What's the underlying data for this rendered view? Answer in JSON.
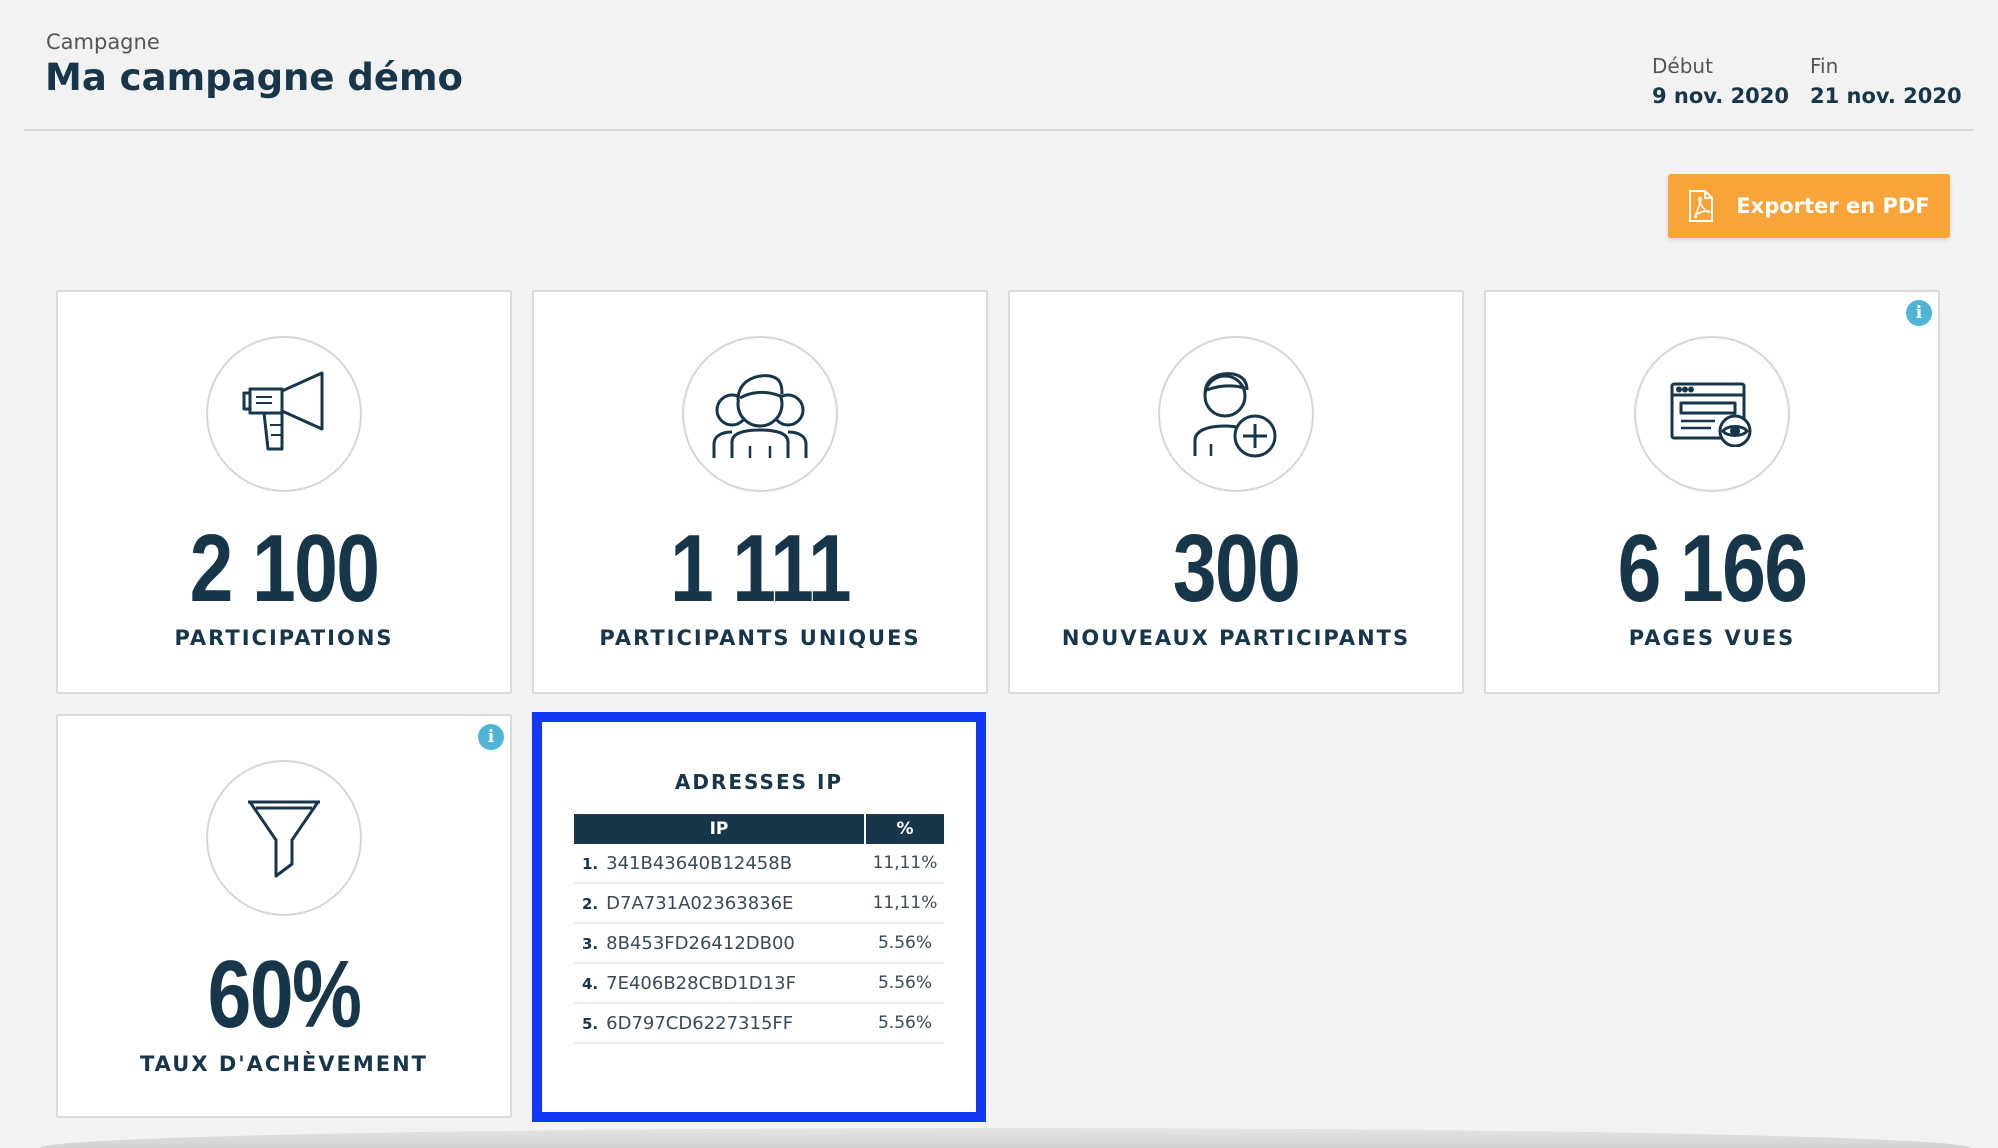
{
  "header": {
    "campaign_label": "Campagne",
    "title": "Ma campagne démo",
    "start_label": "Début",
    "start_date": "9 nov. 2020",
    "end_label": "Fin",
    "end_date": "21 nov. 2020"
  },
  "export": {
    "label": "Exporter en PDF",
    "icon": "pdf-file-icon"
  },
  "stats": [
    {
      "value": "2 100",
      "label": "PARTICIPATIONS",
      "icon": "megaphone-icon"
    },
    {
      "value": "1 111",
      "label": "PARTICIPANTS UNIQUES",
      "icon": "group-icon"
    },
    {
      "value": "300",
      "label": "NOUVEAUX PARTICIPANTS",
      "icon": "user-add-icon"
    },
    {
      "value": "6 166",
      "label": "PAGES VUES",
      "icon": "browser-eye-icon"
    },
    {
      "value": "60%",
      "label": "TAUX D'ACHÈVEMENT",
      "icon": "funnel-icon"
    }
  ],
  "ip_card": {
    "title": "ADRESSES IP",
    "col_ip": "IP",
    "col_pct": "%",
    "rows": [
      {
        "rank": "1.",
        "ip": "341B43640B12458B",
        "pct": "11,11%"
      },
      {
        "rank": "2.",
        "ip": "D7A731A02363836E",
        "pct": "11,11%"
      },
      {
        "rank": "3.",
        "ip": "8B453FD26412DB00",
        "pct": "5.56%"
      },
      {
        "rank": "4.",
        "ip": "7E406B28CBD1D13F",
        "pct": "5.56%"
      },
      {
        "rank": "5.",
        "ip": "6D797CD6227315FF",
        "pct": "5.56%"
      }
    ]
  },
  "colors": {
    "navy": "#17364a",
    "orange": "#f7a43a",
    "info": "#4fb5d6",
    "highlight": "#1436f5"
  }
}
